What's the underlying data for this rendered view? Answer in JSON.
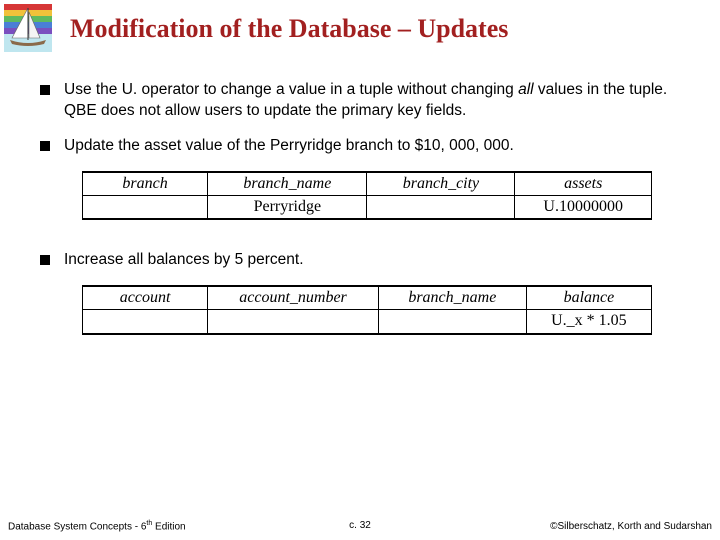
{
  "title": "Modification of the Database – Updates",
  "bullets": {
    "b1_pre": "Use the U. operator to change a value in a tuple without changing ",
    "b1_em": "all",
    "b1_post": " values in the tuple. QBE does not allow users to update the primary key fields.",
    "b2": "Update the asset value of the Perryridge branch to $10, 000, 000.",
    "b3": "Increase all balances by 5 percent."
  },
  "table1": {
    "headers": [
      "branch",
      "branch_name",
      "branch_city",
      "assets"
    ],
    "row": [
      "",
      "Perryridge",
      "",
      "U.10000000"
    ]
  },
  "table2": {
    "headers": [
      "account",
      "account_number",
      "branch_name",
      "balance"
    ],
    "row": [
      "",
      "",
      "",
      "U._x * 1.05"
    ]
  },
  "footer": {
    "left_pre": "Database System Concepts - 6",
    "left_sup": "th",
    "left_post": " Edition",
    "center": "c. 32",
    "right": "©Silberschatz, Korth and Sudarshan"
  },
  "logo": {
    "name": "sailboat-rainbow"
  }
}
